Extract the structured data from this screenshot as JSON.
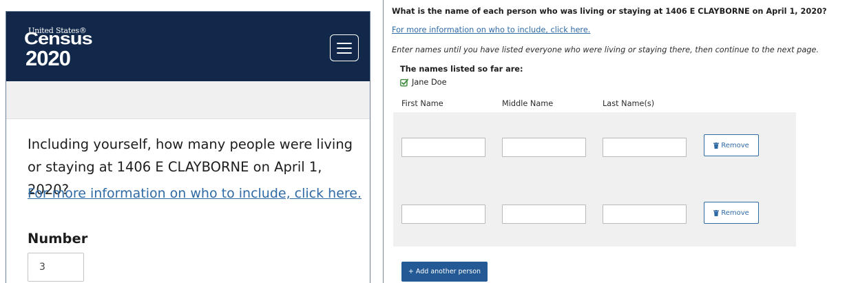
{
  "left": {
    "logo": {
      "line1": "United States®",
      "line2": "Census",
      "line3": "2020"
    },
    "question": "Including yourself, how many people were living or staying at 1406 E CLAYBORNE on April 1, 2020?",
    "more_info_link": "For more information on who to include, click here.",
    "number_label": "Number",
    "number_value": "3"
  },
  "right": {
    "question": "What is the name of each person who was living or staying at 1406 E CLAYBORNE on April 1, 2020?",
    "more_info_link": "For more information on who to include, click here.",
    "instructions": "Enter names until you have listed everyone who were living or staying there, then continue to the next page.",
    "listed_label": "The names listed so far are:",
    "listed_names": [
      "Jane Doe"
    ],
    "columns": {
      "first": "First Name",
      "middle": "Middle Name",
      "last": "Last Name(s)"
    },
    "rows": [
      {
        "first": "",
        "middle": "",
        "last": "",
        "remove_label": "Remove"
      },
      {
        "first": "",
        "middle": "",
        "last": "",
        "remove_label": "Remove"
      }
    ],
    "add_label": "+ Add another person"
  },
  "colors": {
    "header_navy": "#12284a",
    "link_blue": "#2f6aa5",
    "button_blue": "#235a95",
    "check_green": "#3a8a3a"
  },
  "icons": {
    "check": "check-square-icon",
    "trash": "trash-icon",
    "menu": "hamburger-menu-icon"
  }
}
